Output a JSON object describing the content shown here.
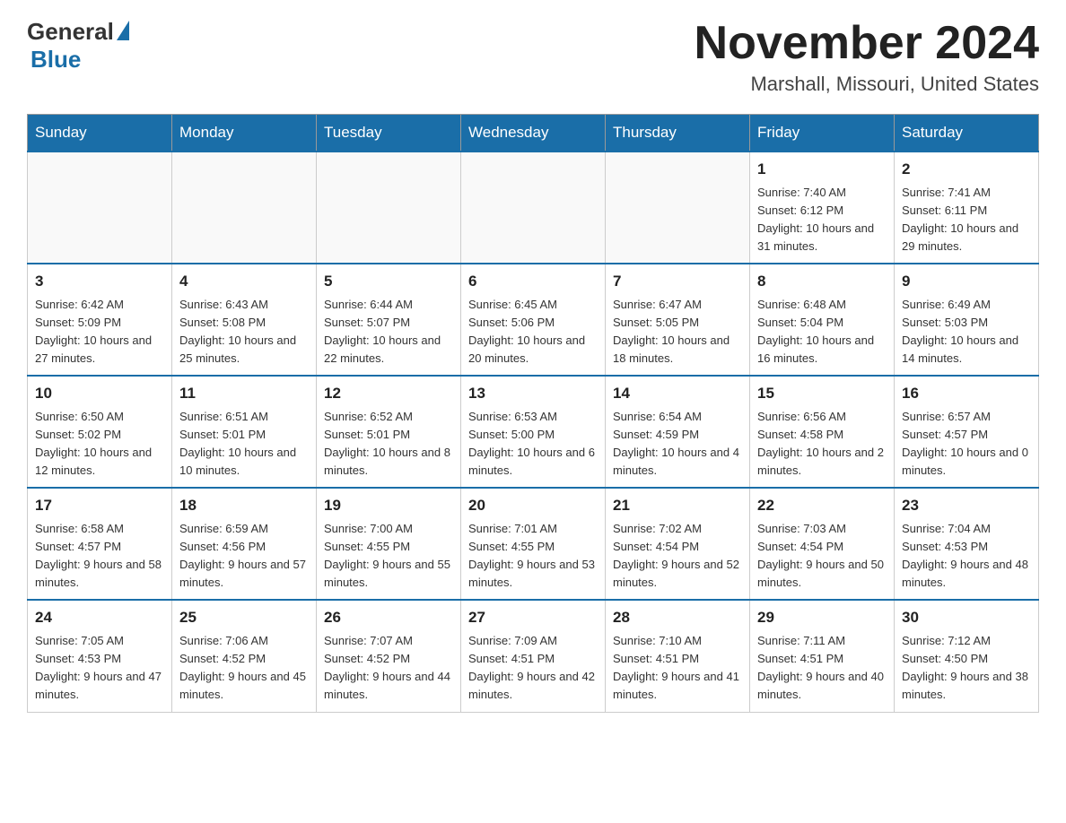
{
  "logo": {
    "general": "General",
    "blue": "Blue"
  },
  "title": {
    "month": "November 2024",
    "location": "Marshall, Missouri, United States"
  },
  "weekdays": [
    "Sunday",
    "Monday",
    "Tuesday",
    "Wednesday",
    "Thursday",
    "Friday",
    "Saturday"
  ],
  "weeks": [
    [
      {
        "day": "",
        "info": ""
      },
      {
        "day": "",
        "info": ""
      },
      {
        "day": "",
        "info": ""
      },
      {
        "day": "",
        "info": ""
      },
      {
        "day": "",
        "info": ""
      },
      {
        "day": "1",
        "info": "Sunrise: 7:40 AM\nSunset: 6:12 PM\nDaylight: 10 hours and 31 minutes."
      },
      {
        "day": "2",
        "info": "Sunrise: 7:41 AM\nSunset: 6:11 PM\nDaylight: 10 hours and 29 minutes."
      }
    ],
    [
      {
        "day": "3",
        "info": "Sunrise: 6:42 AM\nSunset: 5:09 PM\nDaylight: 10 hours and 27 minutes."
      },
      {
        "day": "4",
        "info": "Sunrise: 6:43 AM\nSunset: 5:08 PM\nDaylight: 10 hours and 25 minutes."
      },
      {
        "day": "5",
        "info": "Sunrise: 6:44 AM\nSunset: 5:07 PM\nDaylight: 10 hours and 22 minutes."
      },
      {
        "day": "6",
        "info": "Sunrise: 6:45 AM\nSunset: 5:06 PM\nDaylight: 10 hours and 20 minutes."
      },
      {
        "day": "7",
        "info": "Sunrise: 6:47 AM\nSunset: 5:05 PM\nDaylight: 10 hours and 18 minutes."
      },
      {
        "day": "8",
        "info": "Sunrise: 6:48 AM\nSunset: 5:04 PM\nDaylight: 10 hours and 16 minutes."
      },
      {
        "day": "9",
        "info": "Sunrise: 6:49 AM\nSunset: 5:03 PM\nDaylight: 10 hours and 14 minutes."
      }
    ],
    [
      {
        "day": "10",
        "info": "Sunrise: 6:50 AM\nSunset: 5:02 PM\nDaylight: 10 hours and 12 minutes."
      },
      {
        "day": "11",
        "info": "Sunrise: 6:51 AM\nSunset: 5:01 PM\nDaylight: 10 hours and 10 minutes."
      },
      {
        "day": "12",
        "info": "Sunrise: 6:52 AM\nSunset: 5:01 PM\nDaylight: 10 hours and 8 minutes."
      },
      {
        "day": "13",
        "info": "Sunrise: 6:53 AM\nSunset: 5:00 PM\nDaylight: 10 hours and 6 minutes."
      },
      {
        "day": "14",
        "info": "Sunrise: 6:54 AM\nSunset: 4:59 PM\nDaylight: 10 hours and 4 minutes."
      },
      {
        "day": "15",
        "info": "Sunrise: 6:56 AM\nSunset: 4:58 PM\nDaylight: 10 hours and 2 minutes."
      },
      {
        "day": "16",
        "info": "Sunrise: 6:57 AM\nSunset: 4:57 PM\nDaylight: 10 hours and 0 minutes."
      }
    ],
    [
      {
        "day": "17",
        "info": "Sunrise: 6:58 AM\nSunset: 4:57 PM\nDaylight: 9 hours and 58 minutes."
      },
      {
        "day": "18",
        "info": "Sunrise: 6:59 AM\nSunset: 4:56 PM\nDaylight: 9 hours and 57 minutes."
      },
      {
        "day": "19",
        "info": "Sunrise: 7:00 AM\nSunset: 4:55 PM\nDaylight: 9 hours and 55 minutes."
      },
      {
        "day": "20",
        "info": "Sunrise: 7:01 AM\nSunset: 4:55 PM\nDaylight: 9 hours and 53 minutes."
      },
      {
        "day": "21",
        "info": "Sunrise: 7:02 AM\nSunset: 4:54 PM\nDaylight: 9 hours and 52 minutes."
      },
      {
        "day": "22",
        "info": "Sunrise: 7:03 AM\nSunset: 4:54 PM\nDaylight: 9 hours and 50 minutes."
      },
      {
        "day": "23",
        "info": "Sunrise: 7:04 AM\nSunset: 4:53 PM\nDaylight: 9 hours and 48 minutes."
      }
    ],
    [
      {
        "day": "24",
        "info": "Sunrise: 7:05 AM\nSunset: 4:53 PM\nDaylight: 9 hours and 47 minutes."
      },
      {
        "day": "25",
        "info": "Sunrise: 7:06 AM\nSunset: 4:52 PM\nDaylight: 9 hours and 45 minutes."
      },
      {
        "day": "26",
        "info": "Sunrise: 7:07 AM\nSunset: 4:52 PM\nDaylight: 9 hours and 44 minutes."
      },
      {
        "day": "27",
        "info": "Sunrise: 7:09 AM\nSunset: 4:51 PM\nDaylight: 9 hours and 42 minutes."
      },
      {
        "day": "28",
        "info": "Sunrise: 7:10 AM\nSunset: 4:51 PM\nDaylight: 9 hours and 41 minutes."
      },
      {
        "day": "29",
        "info": "Sunrise: 7:11 AM\nSunset: 4:51 PM\nDaylight: 9 hours and 40 minutes."
      },
      {
        "day": "30",
        "info": "Sunrise: 7:12 AM\nSunset: 4:50 PM\nDaylight: 9 hours and 38 minutes."
      }
    ]
  ]
}
